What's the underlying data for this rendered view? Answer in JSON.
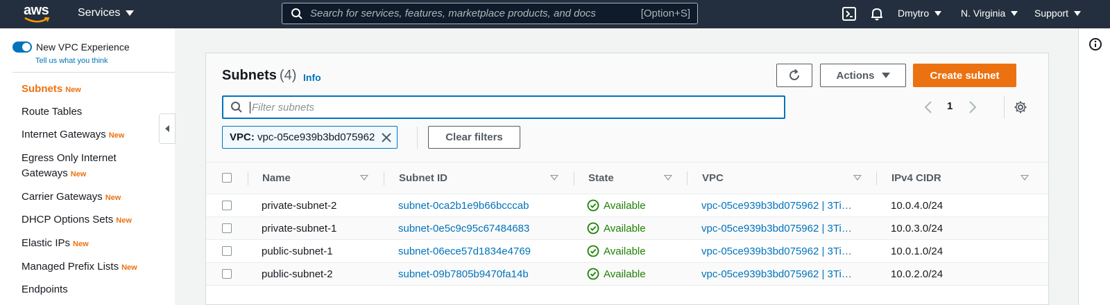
{
  "topnav": {
    "logo_text": "aws",
    "services_label": "Services",
    "search_placeholder": "Search for services, features, marketplace products, and docs",
    "search_shortcut": "[Option+S]",
    "user": "Dmytro",
    "region": "N. Virginia",
    "support": "Support"
  },
  "sidebar": {
    "toggle_label": "New VPC Experience",
    "feedback_link": "Tell us what you think",
    "new_badge": "New",
    "items": [
      {
        "label": "Subnets",
        "new": true,
        "active": true
      },
      {
        "label": "Route Tables",
        "new": false
      },
      {
        "label": "Internet Gateways",
        "new": true
      },
      {
        "label": "Egress Only Internet Gateways",
        "new": true
      },
      {
        "label": "Carrier Gateways",
        "new": true
      },
      {
        "label": "DHCP Options Sets",
        "new": true
      },
      {
        "label": "Elastic IPs",
        "new": true
      },
      {
        "label": "Managed Prefix Lists",
        "new": true
      },
      {
        "label": "Endpoints",
        "new": false
      }
    ]
  },
  "panel": {
    "title": "Subnets",
    "count": "(4)",
    "info_link": "Info",
    "actions_label": "Actions",
    "create_label": "Create subnet",
    "filter_placeholder": "Filter subnets",
    "page": "1",
    "token_key": "VPC:",
    "token_value": "vpc-05ce939b3bd075962",
    "clear_filters": "Clear filters"
  },
  "table": {
    "columns": [
      "Name",
      "Subnet ID",
      "State",
      "VPC",
      "IPv4 CIDR"
    ],
    "rows": [
      {
        "name": "private-subnet-2",
        "subnet_id": "subnet-0ca2b1e9b66bcccab",
        "state": "Available",
        "vpc": "vpc-05ce939b3bd075962 | 3Ti…",
        "cidr": "10.0.4.0/24"
      },
      {
        "name": "private-subnet-1",
        "subnet_id": "subnet-0e5c9c95c67484683",
        "state": "Available",
        "vpc": "vpc-05ce939b3bd075962 | 3Ti…",
        "cidr": "10.0.3.0/24"
      },
      {
        "name": "public-subnet-1",
        "subnet_id": "subnet-06ece57d1834e4769",
        "state": "Available",
        "vpc": "vpc-05ce939b3bd075962 | 3Ti…",
        "cidr": "10.0.1.0/24"
      },
      {
        "name": "public-subnet-2",
        "subnet_id": "subnet-09b7805b9470fa14b",
        "state": "Available",
        "vpc": "vpc-05ce939b3bd075962 | 3Ti…",
        "cidr": "10.0.2.0/24"
      }
    ]
  },
  "colors": {
    "nav_bg": "#232f3e",
    "accent_orange": "#ec7211",
    "link_blue": "#0073bb",
    "status_green": "#1d8102"
  },
  "icons": [
    "search-icon",
    "cloudshell-icon",
    "bell-icon",
    "refresh-icon",
    "settings-icon",
    "info-icon",
    "chevron-left-icon",
    "chevron-right-icon",
    "close-icon",
    "check-circle-icon"
  ]
}
